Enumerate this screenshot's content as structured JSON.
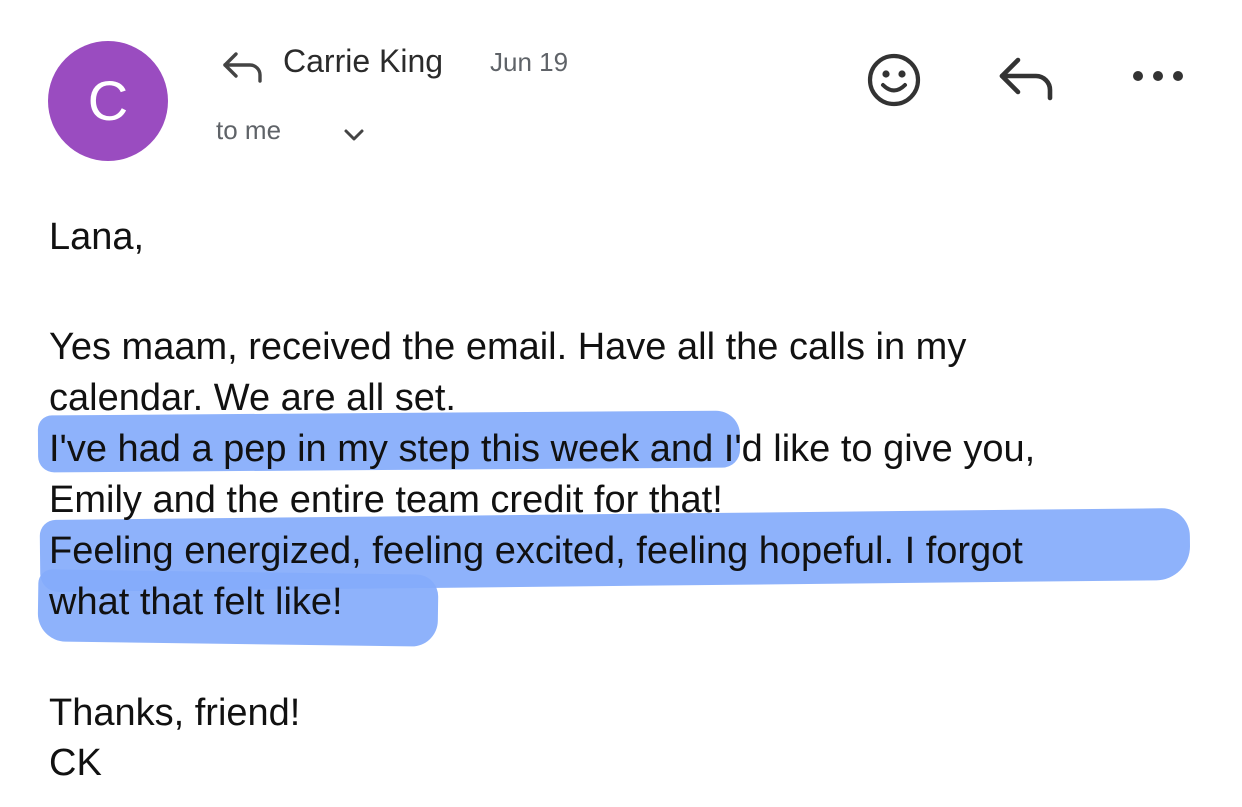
{
  "sender": {
    "avatar_letter": "C",
    "avatar_color": "#9a4cc0",
    "name": "Carrie King",
    "date": "Jun 19",
    "recipient": "to me"
  },
  "actions": {
    "emoji_icon": "smiley-face-icon",
    "reply_icon": "reply-arrow-icon",
    "more_icon": "more-dots-icon",
    "expand_icon": "chevron-down-icon"
  },
  "highlight_color": "#84abfb",
  "message": {
    "greeting": "Lana,",
    "lines": [
      "Yes maam, received the email. Have all the calls in my",
      "calendar. We are all set.",
      "I've had a pep in my step this week and I'd like to give you,",
      "Emily and the entire team credit for that!",
      "Feeling energized, feeling excited, feeling hopeful. I forgot",
      "what that felt like!"
    ],
    "closing": "Thanks, friend!",
    "signature": "CK"
  }
}
